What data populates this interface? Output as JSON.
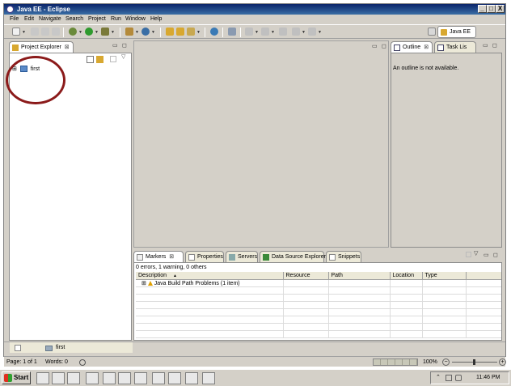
{
  "window": {
    "title": "Java EE - Eclipse",
    "controls": [
      "_",
      "□",
      "X"
    ]
  },
  "menu": [
    "File",
    "Edit",
    "Navigate",
    "Search",
    "Project",
    "Run",
    "Window",
    "Help"
  ],
  "perspective": {
    "label": "Java EE"
  },
  "project_explorer": {
    "tab_label": "Project Explorer",
    "close_glyph": "⊠",
    "tree": [
      {
        "expander": "⊞",
        "label": "first"
      }
    ]
  },
  "outline": {
    "tab_label": "Outline",
    "close_glyph": "⊠",
    "message": "An outline is not available."
  },
  "task_list": {
    "tab_label": "Task Lis"
  },
  "bottom_panel": {
    "tabs": [
      {
        "label": "Markers",
        "close_glyph": "⊠"
      },
      {
        "label": "Properties"
      },
      {
        "label": "Servers"
      },
      {
        "label": "Data Source Explorer"
      },
      {
        "label": "Snippets"
      }
    ],
    "summary": "0 errors, 1 warning, 0 others",
    "columns": [
      "Description",
      "Resource",
      "Path",
      "Location",
      "Type"
    ],
    "sort_glyph": "▲",
    "rows": [
      {
        "expander": "⊞",
        "description": "Java Build Path Problems (1 item)",
        "resource": "",
        "path": "",
        "location": "",
        "type": ""
      }
    ]
  },
  "explorer_footer": {
    "label": "first"
  },
  "statusbar": {
    "page": "Page: 1 of 1",
    "words": "Words: 0",
    "zoom": "100%"
  },
  "taskbar": {
    "start_label": "Start",
    "clock": "11:46 PM"
  },
  "colors": {
    "annotation_circle": "#8b1a1a",
    "titlebar": "#0a246a",
    "chrome": "#d4d0c8"
  }
}
